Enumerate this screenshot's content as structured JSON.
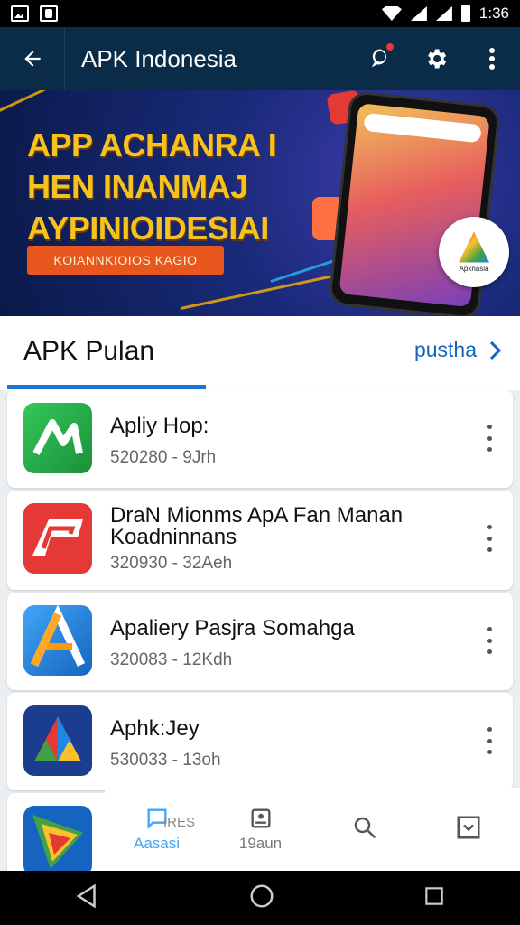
{
  "status": {
    "time": "1:36"
  },
  "appbar": {
    "title": "APK Indonesia"
  },
  "banner": {
    "headline": [
      "APP ACHANRA I",
      "HEN INANMAJ",
      "AYPINIOIDESIAI"
    ],
    "cta": "KOIANNKIOIOS KAGIO",
    "badge_label": "Apknasia"
  },
  "section": {
    "title": "APK Pulan",
    "more": "pustha"
  },
  "apps": [
    {
      "name": "Apliy Hop:",
      "meta": "520280 - 9Jrh",
      "icon": "green-a-icon"
    },
    {
      "name": "DraN Mionms ApA Fan Manan Koadninnans",
      "meta": "320930 - 32Aeh",
      "icon": "red-ap-icon"
    },
    {
      "name": "Apaliery Pasjra Somahga",
      "meta": "320083 - 12Kdh",
      "icon": "blue-orange-a-icon"
    },
    {
      "name": "Aphk:Jey",
      "meta": "530033 - 13oh",
      "icon": "multicolor-triangle-icon"
    },
    {
      "name": "",
      "meta": "",
      "icon": "play-triangle-icon"
    }
  ],
  "nav": [
    {
      "label": "Aasasi",
      "top": "",
      "icon": "chat-icon",
      "active": true
    },
    {
      "label": "19aun",
      "top": "IRES",
      "icon": "badge-icon",
      "active": false
    },
    {
      "label": "",
      "top": "",
      "icon": "search-icon",
      "active": false
    },
    {
      "label": "",
      "top": "",
      "icon": "checkbox-icon",
      "active": false
    }
  ]
}
